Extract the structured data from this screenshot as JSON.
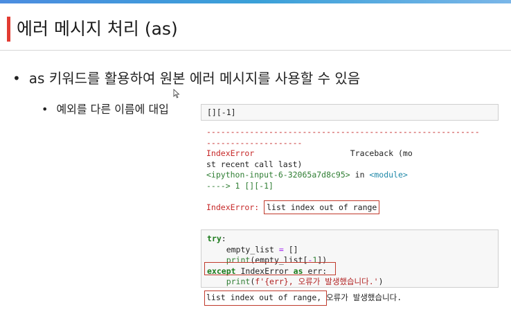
{
  "slide": {
    "title": "에러 메시지 처리 (as)",
    "bullet1": "as 키워드를 활용하여 원본 에러 메시지를 사용할 수 있음",
    "bullet2": "예외를 다른 이름에 대입"
  },
  "cell1": {
    "code": "[][-1]"
  },
  "traceback": {
    "dashes1": "---------------------------------------------------------",
    "dashes2": "--------------------",
    "error_name": "IndexError",
    "traceback_label": "Traceback (mo",
    "traceback_cont": "st recent call last)",
    "input_ref": "<ipython-input-6-32065a7d8c95>",
    "in_word": " in ",
    "module_ref": "<module>",
    "arrow_line": "----> 1 [][-1]",
    "final_error_type": "IndexError:",
    "final_error_msg": "list index out of range"
  },
  "cell2": {
    "line1_kw": "try",
    "line2_var": "empty_list",
    "line3_func": "print",
    "line3_arg": "empty_list",
    "line4_kw": "except",
    "line4_exc": "IndexError",
    "line4_as": "as",
    "line4_var": "err",
    "line5_func": "print",
    "line5_str": "f'{err}, 오류가 발생했습니다.'"
  },
  "output2": {
    "boxed_text": "list index out of range,",
    "rest_text": " 오류가 발생했습니다."
  },
  "colors": {
    "accent": "#e23b32",
    "error_red": "#c62828",
    "keyword_green": "#1b7a1b",
    "link_cyan": "#1e88a8"
  }
}
